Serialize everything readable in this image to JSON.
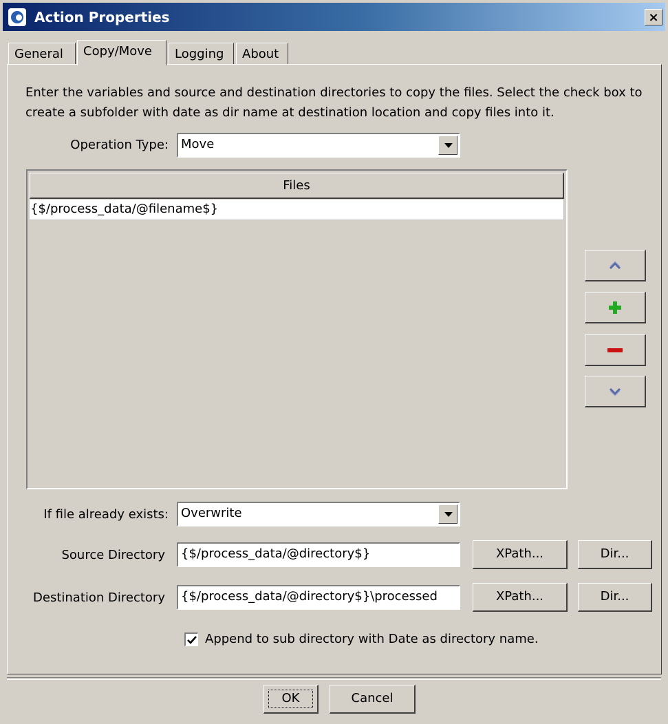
{
  "window": {
    "title": "Action Properties",
    "close_label": "×"
  },
  "tabs": [
    {
      "label": "General",
      "active": false
    },
    {
      "label": "Copy/Move",
      "active": true
    },
    {
      "label": "Logging",
      "active": false
    },
    {
      "label": "About",
      "active": false
    }
  ],
  "description": "Enter the variables and source and destination directories to copy the files. Select the check box to create a subfolder with date as dir name at destination location and copy files into it.",
  "operation_type": {
    "label": "Operation Type:",
    "value": "Move"
  },
  "files_table": {
    "header": "Files",
    "rows": [
      "{$/process_data/@filename$}"
    ]
  },
  "side_buttons": {
    "up": "chevron-up-icon",
    "add": "plus-icon",
    "remove": "minus-icon",
    "down": "chevron-down-icon"
  },
  "if_exists": {
    "label": "If file already exists:",
    "value": "Overwrite"
  },
  "source_dir": {
    "label": "Source Directory",
    "value": "{$/process_data/@directory$}",
    "xpath_btn": "XPath...",
    "dir_btn": "Dir..."
  },
  "dest_dir": {
    "label": "Destination Directory",
    "value": "{$/process_data/@directory$}\\processed",
    "xpath_btn": "XPath...",
    "dir_btn": "Dir..."
  },
  "append_date": {
    "label": "Append to sub directory with Date as directory name.",
    "checked": true
  },
  "footer": {
    "ok": "OK",
    "cancel": "Cancel"
  },
  "colors": {
    "face": "#d4d0c8",
    "title_start": "#0a246a",
    "title_end": "#a6caf0",
    "plus": "#22aa22",
    "minus": "#cc1111",
    "chevron": "#5a6aa8"
  }
}
